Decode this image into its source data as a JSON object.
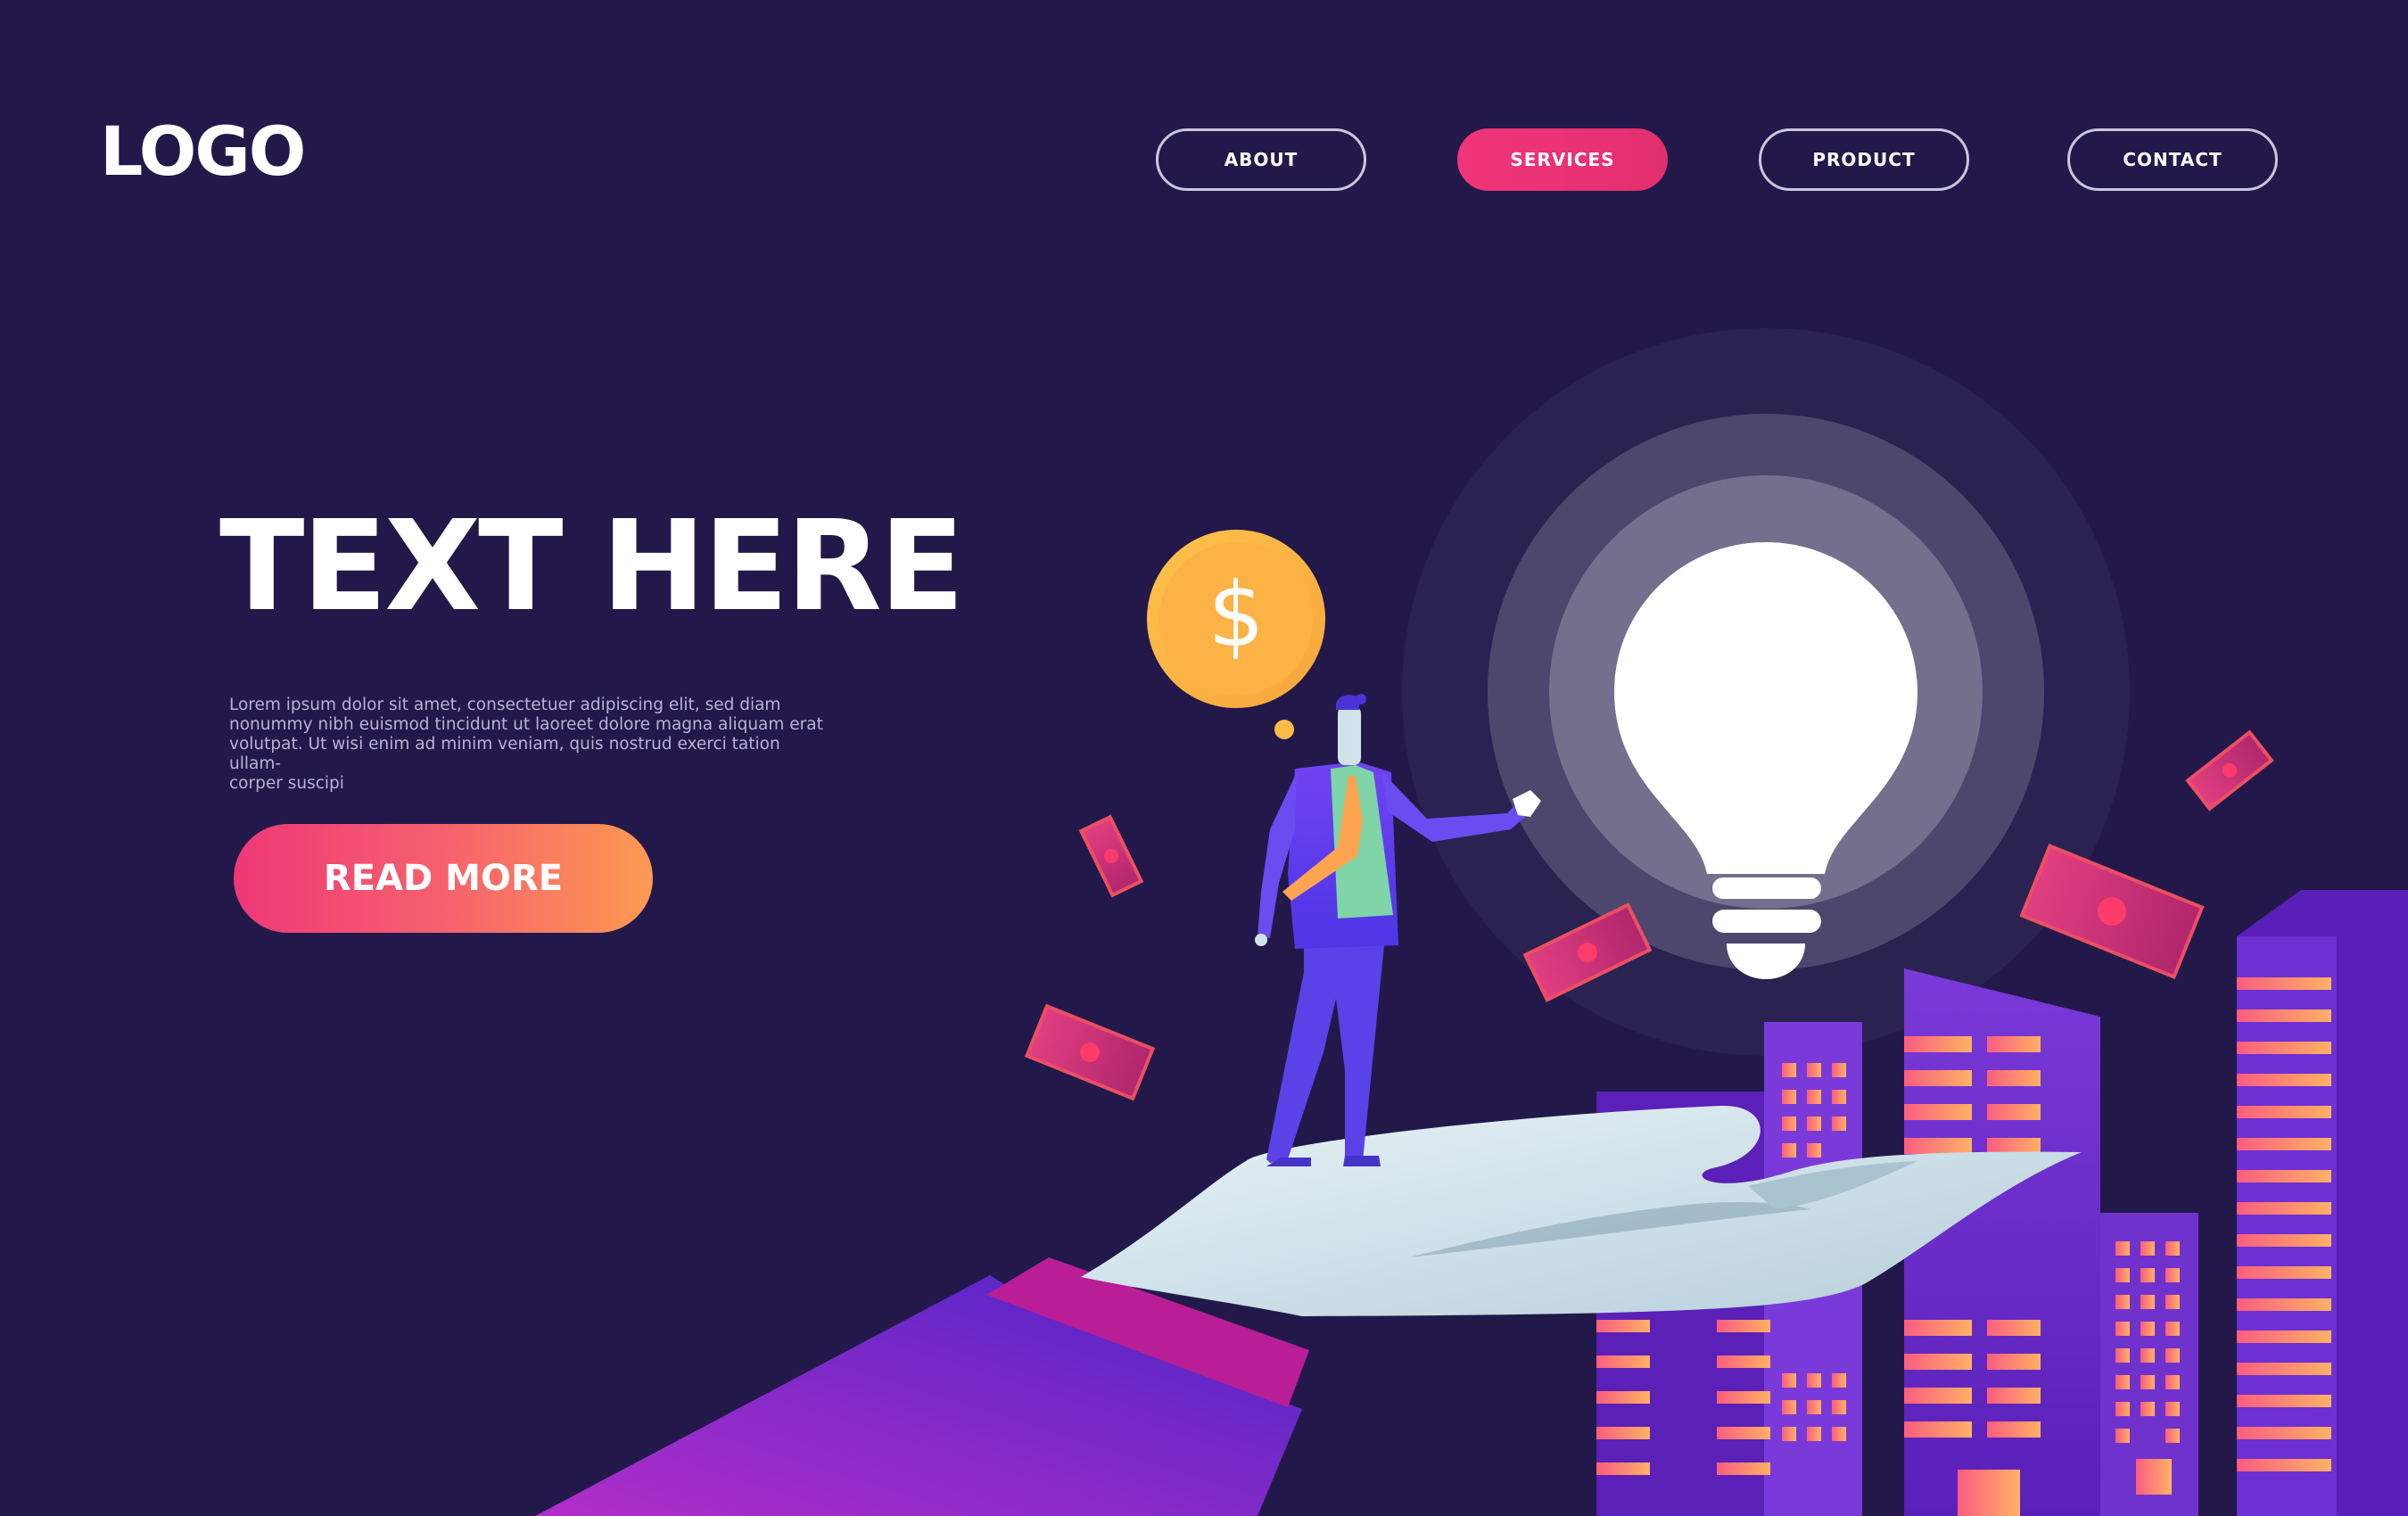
{
  "header": {
    "logo": "LOGO",
    "nav": [
      {
        "label": "ABOUT",
        "active": false
      },
      {
        "label": "SERVICES",
        "active": true
      },
      {
        "label": "PRODUCT",
        "active": false
      },
      {
        "label": "CONTACT",
        "active": false
      }
    ]
  },
  "hero": {
    "headline": "TEXT HERE",
    "body_lines": [
      "Lorem ipsum dolor sit amet, consectetuer adipiscing elit, sed diam",
      "nonummy nibh euismod tincidunt ut laoreet dolore magna aliquam erat",
      "volutpat. Ut wisi enim ad minim veniam, quis nostrud exerci tation ullam-",
      "corper suscipi"
    ],
    "cta_label": "READ MORE"
  },
  "illustration": {
    "coin_symbol": "$",
    "icons": [
      "dollar-coin-icon",
      "light-bulb-icon",
      "businessman-figure",
      "giant-hand",
      "city-buildings",
      "banknote-icon"
    ]
  },
  "colors": {
    "background": "#22194a",
    "accent_pink": "#f0357a",
    "accent_orange": "#fc9a52",
    "violet": "#6a36f2"
  }
}
